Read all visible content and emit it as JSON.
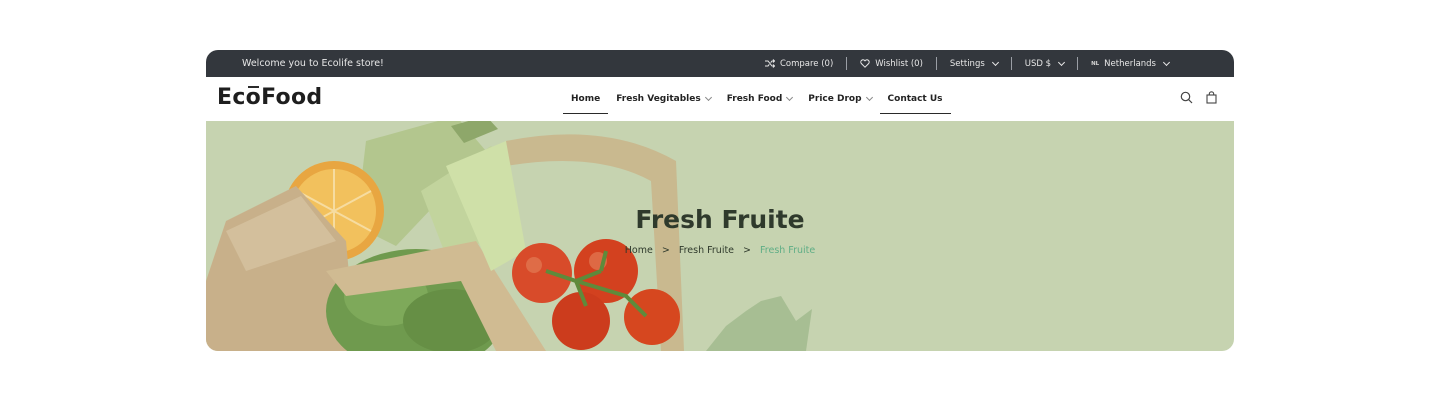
{
  "topbar": {
    "welcome": "Welcome you to Ecolife store!",
    "compare": "Compare (0)",
    "wishlist": "Wishlist (0)",
    "settings": "Settings",
    "currency": "USD $",
    "flag_code": "NL",
    "language": "Netherlands"
  },
  "header": {
    "logo_a": "Ec",
    "logo_o": "o",
    "logo_b": "Food",
    "nav": {
      "home": "Home",
      "fresh_vegetables": "Fresh Vegitables",
      "fresh_food": "Fresh Food",
      "price_drop": "Price Drop",
      "contact": "Contact Us"
    }
  },
  "hero": {
    "title": "Fresh Fruite",
    "breadcrumb": {
      "home": "Home",
      "sep": ">",
      "parent": "Fresh Fruite",
      "current": "Fresh Fruite"
    }
  },
  "colors": {
    "topbar_bg": "#33373d",
    "hero_bg": "#c6d3b0",
    "breadcrumb_active": "#5fae86"
  },
  "icons": [
    "shuffle-icon",
    "heart-icon",
    "chevron-down-icon",
    "search-icon",
    "bag-icon"
  ]
}
